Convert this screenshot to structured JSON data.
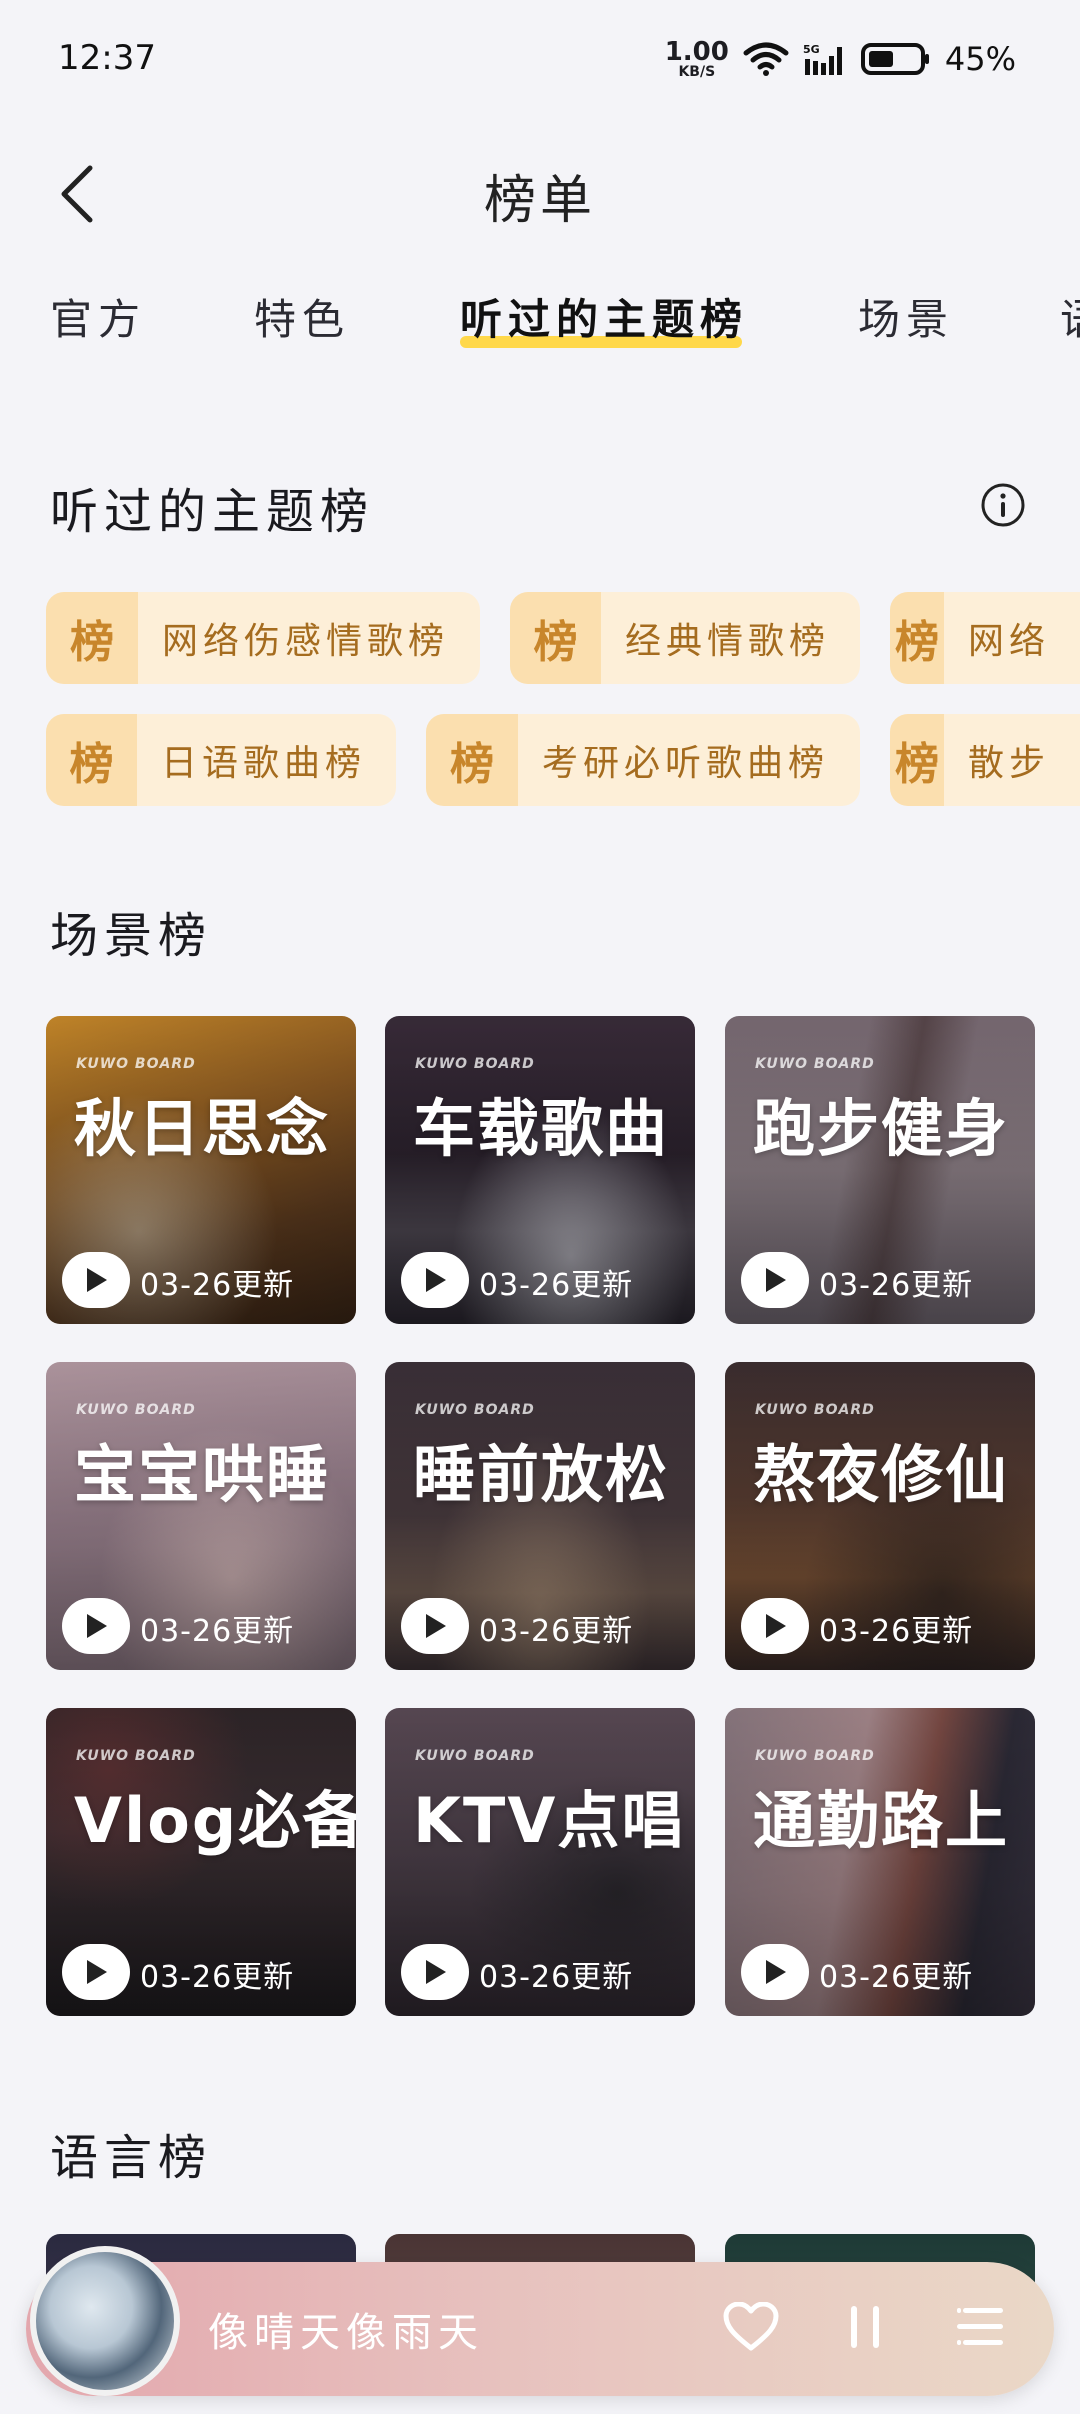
{
  "status_bar": {
    "time": "12:37",
    "net_speed_value": "1.00",
    "net_speed_unit": "KB/S",
    "signal_label": "5G",
    "battery_percent": "45%"
  },
  "header": {
    "title": "榜单"
  },
  "tabs": [
    {
      "label": "官方",
      "active": false
    },
    {
      "label": "特色",
      "active": false
    },
    {
      "label": "听过的主题榜",
      "active": true
    },
    {
      "label": "场景",
      "active": false
    },
    {
      "label": "语",
      "active": false
    }
  ],
  "listened": {
    "title": "听过的主题榜",
    "badge": "榜",
    "chips_row1": [
      "网络伤感情歌榜",
      "经典情歌榜",
      "网络"
    ],
    "chips_row2": [
      "日语歌曲榜",
      "考研必听歌曲榜",
      "散步"
    ]
  },
  "scene": {
    "title": "场景榜",
    "brand": "KUWO BOARD",
    "cards": [
      {
        "title": "秋日思念",
        "date": "03-26更新"
      },
      {
        "title": "车载歌曲",
        "date": "03-26更新"
      },
      {
        "title": "跑步健身",
        "date": "03-26更新"
      },
      {
        "title": "宝宝哄睡",
        "date": "03-26更新"
      },
      {
        "title": "睡前放松",
        "date": "03-26更新"
      },
      {
        "title": "熬夜修仙",
        "date": "03-26更新"
      },
      {
        "title": "Vlog必备",
        "date": "03-26更新"
      },
      {
        "title": "KTV点唱",
        "date": "03-26更新"
      },
      {
        "title": "通勤路上",
        "date": "03-26更新"
      }
    ]
  },
  "language": {
    "title": "语言榜"
  },
  "player": {
    "song_title": "像晴天像雨天"
  },
  "colors": {
    "accent_yellow": "#ffd84a",
    "chip_bg": "#fdefd8",
    "chip_text": "#a56c1f"
  }
}
